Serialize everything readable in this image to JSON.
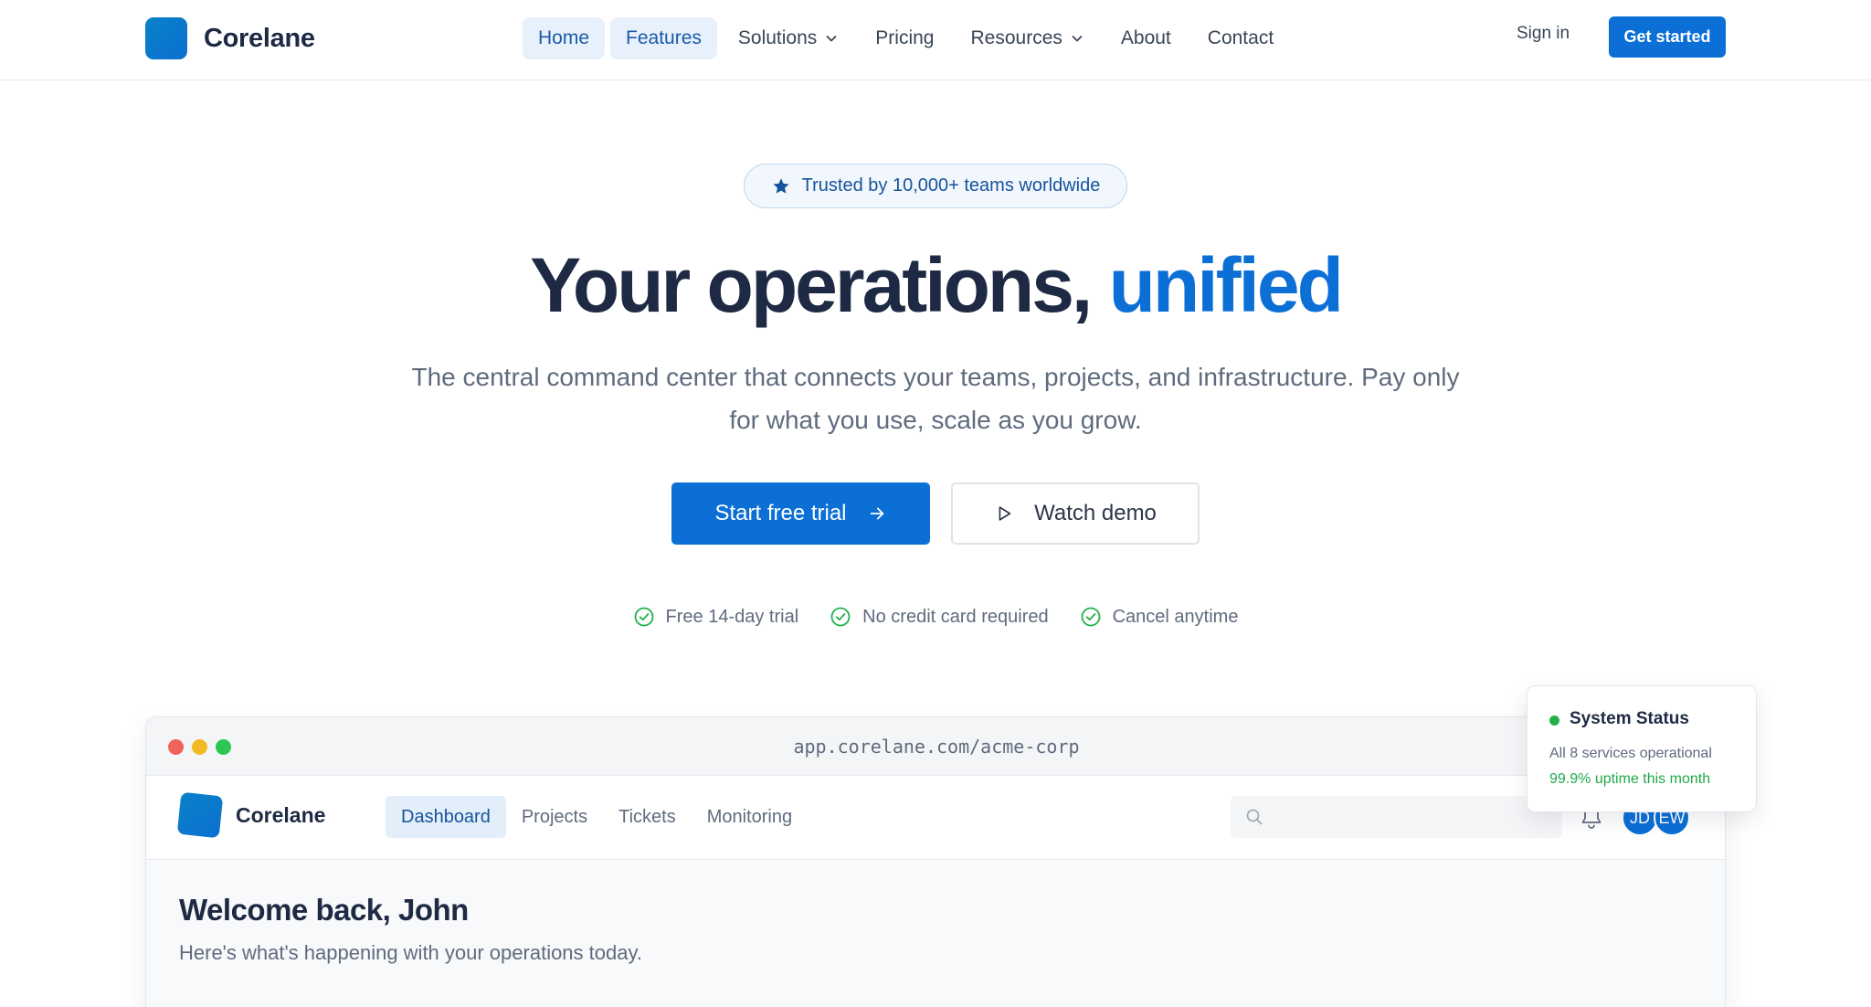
{
  "brand": {
    "name": "Corelane"
  },
  "nav": {
    "items": [
      {
        "label": "Home",
        "active": true,
        "dropdown": false
      },
      {
        "label": "Features",
        "active": true,
        "dropdown": false
      },
      {
        "label": "Solutions",
        "active": false,
        "dropdown": true
      },
      {
        "label": "Pricing",
        "active": false,
        "dropdown": false
      },
      {
        "label": "Resources",
        "active": false,
        "dropdown": true
      },
      {
        "label": "About",
        "active": false,
        "dropdown": false
      },
      {
        "label": "Contact",
        "active": false,
        "dropdown": false
      }
    ],
    "sign_in": "Sign in",
    "get_started": "Get started"
  },
  "hero": {
    "badge": "Trusted by 10,000+ teams worldwide",
    "headline_main": "Your operations, ",
    "headline_accent": "unified",
    "subtitle": "The central command center that connects your teams, projects, and infrastructure. Pay only for what you use, scale as you grow.",
    "primary_cta": "Start free trial",
    "secondary_cta": "Watch demo",
    "perks": [
      "Free 14-day trial",
      "No credit card required",
      "Cancel anytime"
    ]
  },
  "mockup": {
    "url": "app.corelane.com/acme-corp",
    "brand": "Corelane",
    "nav": [
      {
        "label": "Dashboard",
        "active": true
      },
      {
        "label": "Projects",
        "active": false
      },
      {
        "label": "Tickets",
        "active": false
      },
      {
        "label": "Monitoring",
        "active": false
      }
    ],
    "search_placeholder": "",
    "avatars": [
      "JD",
      "EW"
    ],
    "welcome_title": "Welcome back, John",
    "welcome_subtitle": "Here's what's happening with your operations today."
  },
  "status_card": {
    "title": "System Status",
    "services": "All 8 services operational",
    "uptime": "99.9% uptime this month"
  },
  "colors": {
    "primary": "#0b6fd6",
    "accent_text": "#0b6fd6",
    "heading": "#1e2a44",
    "success": "#22b04b",
    "traffic_red": "#f0625c",
    "traffic_yellow": "#f3b925",
    "traffic_green": "#2dc653"
  },
  "icons": {
    "badge": "star-icon",
    "primary_cta": "arrow-right-icon",
    "secondary_cta": "play-icon",
    "perk": "check-circle-icon",
    "dropdown": "chevron-down-icon",
    "search": "search-icon",
    "notifications": "bell-icon"
  }
}
